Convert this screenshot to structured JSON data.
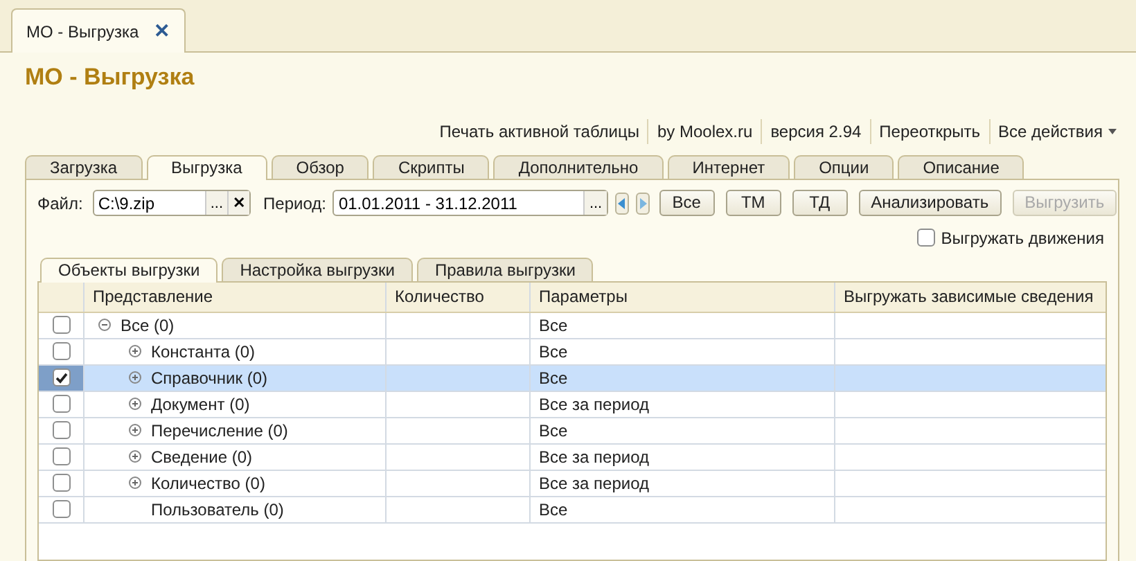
{
  "window": {
    "tab": "МО - Выгрузка",
    "close": "✕",
    "title": "МО - Выгрузка"
  },
  "commands": [
    {
      "label": "Печать активной таблицы"
    },
    {
      "label": "by Moolex.ru"
    },
    {
      "label": "версия 2.94"
    },
    {
      "label": "Переоткрыть"
    },
    {
      "label": "Все действия",
      "dropdown": true
    }
  ],
  "tabs": [
    {
      "label": "Загрузка",
      "selected": false
    },
    {
      "label": "Выгрузка",
      "selected": true
    },
    {
      "label": "Обзор",
      "selected": false
    },
    {
      "label": "Скрипты",
      "selected": false
    },
    {
      "label": "Дополнительно",
      "selected": false
    },
    {
      "label": "Интернет",
      "selected": false
    },
    {
      "label": "Опции",
      "selected": false
    },
    {
      "label": "Описание",
      "selected": false
    }
  ],
  "file": {
    "label": "Файл:",
    "value": "C:\\9.zip",
    "browse": "...",
    "clear": "✕"
  },
  "period": {
    "label": "Период:",
    "value": "01.01.2011 - 31.12.2011",
    "browse": "..."
  },
  "buttons": [
    {
      "label": "Все",
      "disabled": false
    },
    {
      "label": "ТМ",
      "disabled": false
    },
    {
      "label": "ТД",
      "disabled": false
    },
    {
      "label": "Анализировать",
      "disabled": false
    },
    {
      "label": "Выгрузить",
      "disabled": true
    }
  ],
  "movements": {
    "label": "Выгружать движения",
    "checked": false
  },
  "subtabs": [
    {
      "label": "Объекты выгрузки",
      "selected": true
    },
    {
      "label": "Настройка выгрузки",
      "selected": false
    },
    {
      "label": "Правила выгрузки",
      "selected": false
    }
  ],
  "table": {
    "columns": [
      "Представление",
      "Количество",
      "Параметры",
      "Выгружать зависимые сведения"
    ],
    "rows": [
      {
        "name": "Все (0)",
        "params": "Все",
        "checked": false,
        "selected": false,
        "expanded": true,
        "children": [
          {
            "name": "Константа (0)",
            "params": "Все",
            "checked": false,
            "selected": false,
            "expanded": false
          },
          {
            "name": "Справочник (0)",
            "params": "Все",
            "checked": true,
            "selected": true,
            "expanded": false
          },
          {
            "name": "Документ (0)",
            "params": "Все за период",
            "checked": false,
            "selected": false,
            "expanded": false
          },
          {
            "name": "Перечисление (0)",
            "params": "Все",
            "checked": false,
            "selected": false,
            "expanded": false
          },
          {
            "name": "Сведение (0)",
            "params": "Все за период",
            "checked": false,
            "selected": false,
            "expanded": false
          },
          {
            "name": "Количество (0)",
            "params": "Все за период",
            "checked": false,
            "selected": false,
            "expanded": false
          },
          {
            "name": "Пользователь (0)",
            "params": "Все",
            "checked": false,
            "selected": false
          }
        ]
      }
    ]
  }
}
